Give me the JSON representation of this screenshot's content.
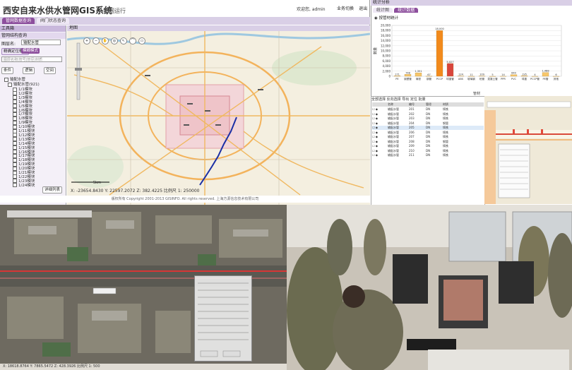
{
  "gis_window": {
    "title": "西安自来水供水管网GIS系统",
    "subtitle": "管网运行",
    "user_text": "欢迎您, admin",
    "header_buttons": [
      "业务切换",
      "退出"
    ],
    "tabs": [
      "管网数据查询",
      "阀门状态查询"
    ],
    "left_panel": {
      "toolbox_label": "工具箱",
      "section_label": "管网结构查询",
      "layer_label": "图层名:",
      "layer_value": "输配水管",
      "mode_buttons": [
        "精确定位模式",
        "模糊模式"
      ],
      "search_placeholder": "图层名称|管号|管径|材质",
      "action_buttons": [
        "条件",
        "逻辑",
        "空间"
      ],
      "tree_root": "输配水管",
      "tree_sub": "输配水管(921)",
      "tree_items": [
        "1/1模块",
        "1/2模块",
        "1/3模块",
        "1/4模块",
        "1/5模块",
        "1/6模块",
        "1/7模块",
        "1/8模块",
        "1/9模块",
        "1/10模块",
        "1/11模块",
        "1/12模块",
        "1/13模块",
        "1/14模块",
        "1/15模块",
        "1/16模块",
        "1/17模块",
        "1/18模块",
        "1/19模块",
        "1/20模块",
        "1/21模块",
        "1/22模块",
        "1/23模块",
        "1/24模块"
      ],
      "detail_button": "详细列表"
    },
    "map": {
      "header": "地图",
      "coords": "X: -23654.8430   Y: 22597.2072   Z: 382.4225   比例尺   1: 250000",
      "scalebar_label": "5km"
    },
    "footer": "版权所有 Copyright 2001-2013 GISINFO. All rights reserved. 上海方源信息技术有限公司"
  },
  "stats_window": {
    "header": "统计分析",
    "tabs": [
      "统计图",
      "统计数据"
    ],
    "radio_label": "按管材统计",
    "colors": {
      "bar_top": "#f6c66a",
      "bar_highlight": "#f28a1c",
      "bar_red": "#d8453c"
    }
  },
  "chart_data": {
    "type": "bar",
    "categories": [
      "PE",
      "钢塑管",
      "铸铁",
      "钢管",
      "PCCP",
      "球墨管",
      "ABS",
      "玻璃钢",
      "砼管",
      "混凝土管",
      "PPR",
      "PVC",
      "球墨",
      "PCCP管",
      "PE管",
      "其他"
    ],
    "values": [
      171,
      748,
      1351,
      67,
      18000,
      5027,
      124,
      11,
      109,
      5,
      14,
      640,
      195,
      4,
      1488,
      6
    ],
    "ylim": [
      0,
      20000
    ],
    "yticks": [
      0,
      2000,
      4000,
      6000,
      8000,
      10000,
      12000,
      14000,
      16000,
      18000,
      20000
    ],
    "ylabel": "数量",
    "xlabel": "管材"
  },
  "attr_table": {
    "toolbar": [
      "全部选择",
      "反向选择",
      "导出",
      "定位",
      "批量"
    ],
    "columns": [
      "",
      "",
      "名称",
      "编号",
      "管径",
      "材质"
    ],
    "rows": [
      [
        "输配水管",
        "201",
        "DN",
        "铸铁"
      ],
      [
        "输配水管",
        "202",
        "DN",
        "铸铁"
      ],
      [
        "输配水管",
        "203",
        "DN",
        "铸铁"
      ],
      [
        "输配水管",
        "204",
        "DN",
        "钢管"
      ],
      [
        "输配水管",
        "205",
        "DN",
        "铸铁"
      ],
      [
        "输配水管",
        "206",
        "DN",
        "铸铁"
      ],
      [
        "输配水管",
        "207",
        "DN",
        "铸铁"
      ],
      [
        "输配水管",
        "208",
        "DN",
        "钢管"
      ],
      [
        "输配水管",
        "209",
        "DN",
        "铸铁"
      ],
      [
        "输配水管",
        "210",
        "DN",
        "铸铁"
      ],
      [
        "输配水管",
        "211",
        "DN",
        "铸铁"
      ]
    ]
  },
  "satellite": {
    "status": "X: 18618.8764   Y: 7865.5472   Z: 428.3926   比例尺   1: 500"
  }
}
